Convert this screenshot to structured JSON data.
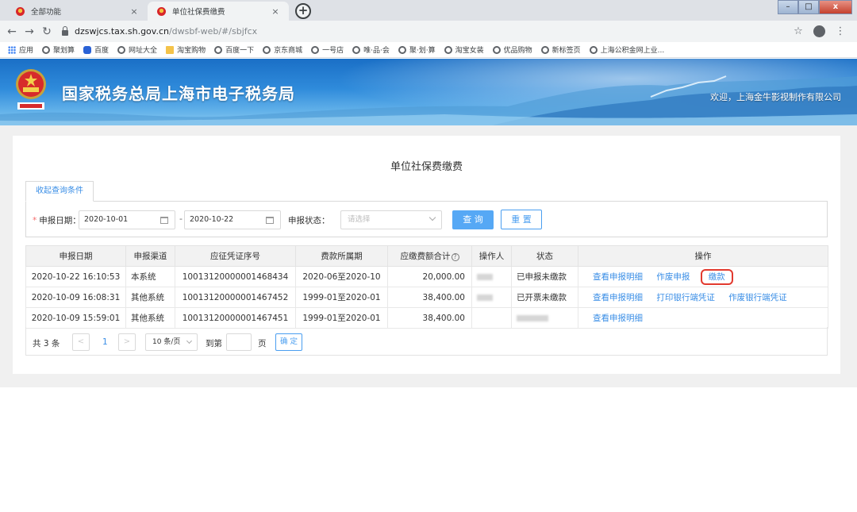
{
  "browser": {
    "tabs": [
      {
        "title": "全部功能",
        "close": "×"
      },
      {
        "title": "单位社保费缴费",
        "close": "×"
      }
    ],
    "newtab": "+",
    "window_buttons": {
      "min": "–",
      "max": "□",
      "close": "x"
    },
    "nav": {
      "back": "←",
      "forward": "→",
      "reload": "↻"
    },
    "url_host": "dzswjcs.tax.sh.gov.cn",
    "url_path": "/dwsbf-web/#/sbjfcx",
    "right_icons": {
      "star": "☆",
      "menu": "⋮"
    },
    "bookmarks": [
      "应用",
      "聚划算",
      "百度",
      "网址大全",
      "淘宝购物",
      "百度一下",
      "京东商城",
      "一号店",
      "唯·品·会",
      "聚·划·算",
      "淘宝女装",
      "优品购物",
      "新标签页",
      "上海公积金网上业..."
    ]
  },
  "site": {
    "title": "国家税务总局上海市电子税务局",
    "welcome": "欢迎，上海金牛影视制作有限公司"
  },
  "page": {
    "heading": "单位社保费缴费",
    "filter_tab": "收起查询条件",
    "filters": {
      "date_label": "申报日期：",
      "date_required": "*",
      "date_from": "2020-10-01",
      "date_sep": "-",
      "date_to": "2020-10-22",
      "status_label": "申报状态：",
      "status_placeholder": "请选择",
      "query_button": "查 询",
      "reset_button": "重 置"
    },
    "table": {
      "headers": [
        "申报日期",
        "申报渠道",
        "应征凭证序号",
        "费款所属期",
        "应缴费额合计",
        "操作人",
        "状态",
        "操作"
      ],
      "help_mark": "?",
      "rows": [
        {
          "date": "2020-10-22 16:10:53",
          "channel": "本系统",
          "voucher": "10013120000001468434",
          "period": "2020-06至2020-10",
          "amount": "20,000.00",
          "status": "已申报未缴款",
          "ops": [
            "查看申报明细",
            "作废申报",
            "缴款"
          ]
        },
        {
          "date": "2020-10-09 16:08:31",
          "channel": "其他系统",
          "voucher": "10013120000001467452",
          "period": "1999-01至2020-01",
          "amount": "38,400.00",
          "status": "已开票未缴款",
          "ops": [
            "查看申报明细",
            "打印银行端凭证",
            "作废银行端凭证"
          ]
        },
        {
          "date": "2020-10-09 15:59:01",
          "channel": "其他系统",
          "voucher": "10013120000001467451",
          "period": "1999-01至2020-01",
          "amount": "38,400.00",
          "status": "",
          "ops": [
            "查看申报明细"
          ]
        }
      ]
    },
    "pager": {
      "total": "共 3 条",
      "prev": "<",
      "current": "1",
      "next": ">",
      "page_size": "10 条/页",
      "goto_label": "到第",
      "page_unit": "页",
      "confirm": "确 定"
    }
  }
}
